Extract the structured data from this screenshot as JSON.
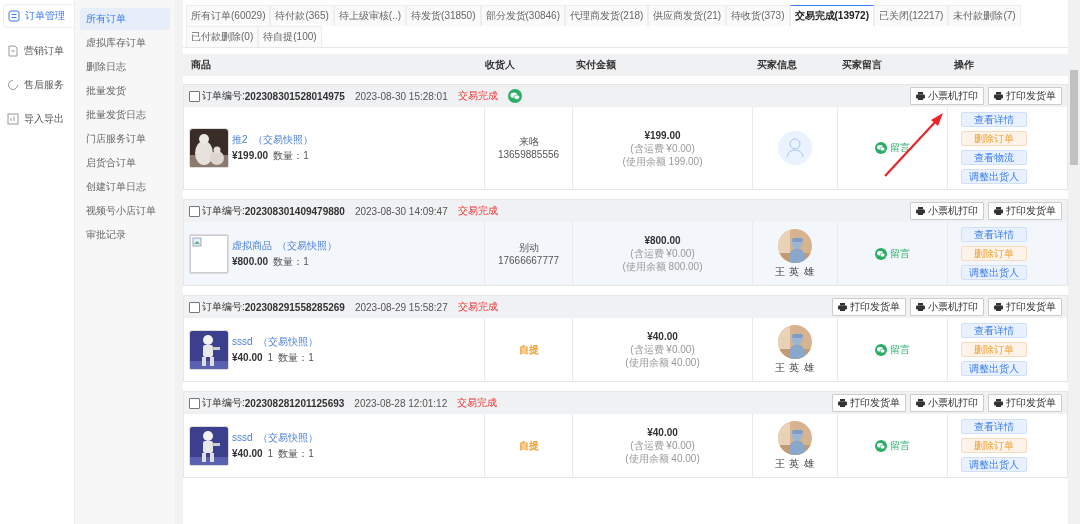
{
  "sidebar": {
    "items": [
      {
        "label": "订单管理",
        "selected": true
      },
      {
        "label": "营销订单",
        "selected": false
      },
      {
        "label": "售后服务",
        "selected": false
      },
      {
        "label": "导入导出",
        "selected": false
      }
    ]
  },
  "submenu": {
    "items": [
      {
        "label": "所有订单",
        "selected": true
      },
      {
        "label": "虚拟库存订单",
        "selected": false
      },
      {
        "label": "删除日志",
        "selected": false
      },
      {
        "label": "批量发货",
        "selected": false
      },
      {
        "label": "批量发货日志",
        "selected": false
      },
      {
        "label": "门店服务订单",
        "selected": false
      },
      {
        "label": "启货合订单",
        "selected": false
      },
      {
        "label": "创建订单日志",
        "selected": false
      },
      {
        "label": "视频号小店订单",
        "selected": false
      },
      {
        "label": "审批记录",
        "selected": false
      }
    ]
  },
  "tabs": [
    {
      "label": "所有订单(60029)",
      "selected": false
    },
    {
      "label": "待付款(365)",
      "selected": false
    },
    {
      "label": "待上级审核(..)",
      "selected": false
    },
    {
      "label": "待发货(31850)",
      "selected": false
    },
    {
      "label": "部分发货(30846)",
      "selected": false
    },
    {
      "label": "代理商发货(218)",
      "selected": false
    },
    {
      "label": "供应商发货(21)",
      "selected": false
    },
    {
      "label": "待收货(373)",
      "selected": false
    },
    {
      "label": "交易完成(13972)",
      "selected": true
    },
    {
      "label": "已关闭(12217)",
      "selected": false
    },
    {
      "label": "未付款删除(7)",
      "selected": false
    },
    {
      "label": "已付款删除(0)",
      "selected": false
    },
    {
      "label": "待自提(100)",
      "selected": false
    }
  ],
  "table": {
    "columns": [
      "商品",
      "收货人",
      "实付金额",
      "买家信息",
      "买家留言",
      "操作"
    ],
    "orders": [
      {
        "checked": false,
        "number_label": "订单编号:",
        "number": "202308301528014975",
        "time": "2023-08-30 15:28:01",
        "status": "交易完成",
        "wechat": true,
        "print_buttons": [
          "小票机打印",
          "打印发货单"
        ],
        "highlight": false,
        "product": {
          "name": "推2",
          "snapshot": "（交易快照）",
          "price": "¥199.00",
          "qty": "数量：1"
        },
        "receiver": {
          "kind": "contact",
          "name": "来咯",
          "phone": "13659885556"
        },
        "amount": {
          "total": "¥199.00",
          "shipping": "(含运费 ¥0.00)",
          "balance": "(使用余额 199.00)"
        },
        "buyer": {
          "kind": "default"
        },
        "message": "留言",
        "actions": [
          {
            "label": "查看详情",
            "kind": "info"
          },
          {
            "label": "删除订单",
            "kind": "danger"
          },
          {
            "label": "查看物流",
            "kind": "info"
          },
          {
            "label": "调整出货人",
            "kind": "info"
          }
        ]
      },
      {
        "checked": false,
        "number_label": "订单编号:",
        "number": "202308301409479880",
        "time": "2023-08-30 14:09:47",
        "status": "交易完成",
        "wechat": false,
        "print_buttons": [
          "小票机打印",
          "打印发货单"
        ],
        "highlight": true,
        "product": {
          "kind": "broken",
          "name": "虚拟商品",
          "snapshot": "（交易快照）",
          "price": "¥800.00",
          "qty": "数量：1"
        },
        "receiver": {
          "kind": "contact",
          "name": "别动",
          "phone": "17666667777"
        },
        "amount": {
          "total": "¥800.00",
          "shipping": "(含运费 ¥0.00)",
          "balance": "(使用余额 800.00)"
        },
        "buyer": {
          "name": "王 英 雄"
        },
        "message": "留言",
        "actions": [
          {
            "label": "查看详情",
            "kind": "info"
          },
          {
            "label": "删除订单",
            "kind": "danger"
          },
          {
            "label": "调整出货人",
            "kind": "info"
          }
        ]
      },
      {
        "checked": false,
        "number_label": "订单编号:",
        "number": "202308291558285269",
        "time": "2023-08-29 15:58:27",
        "status": "交易完成",
        "wechat": false,
        "print_buttons": [
          "打印发货单",
          "小票机打印",
          "打印发货单"
        ],
        "highlight": false,
        "product": {
          "kind": "figure",
          "name": "sssd",
          "snapshot": "（交易快照）",
          "price": "¥40.00",
          "extra": "1",
          "qty": "数量：1"
        },
        "receiver": {
          "kind": "pickup",
          "name": "自提"
        },
        "amount": {
          "total": "¥40.00",
          "shipping": "(含运费 ¥0.00)",
          "balance": "(使用余额 40.00)"
        },
        "buyer": {
          "name": "王 英 雄"
        },
        "message": "留言",
        "actions": [
          {
            "label": "查看详情",
            "kind": "info"
          },
          {
            "label": "删除订单",
            "kind": "danger"
          },
          {
            "label": "调整出货人",
            "kind": "info"
          }
        ]
      },
      {
        "checked": false,
        "number_label": "订单编号:",
        "number": "202308281201125693",
        "time": "2023-08-28 12:01:12",
        "status": "交易完成",
        "wechat": false,
        "print_buttons": [
          "打印发货单",
          "小票机打印",
          "打印发货单"
        ],
        "highlight": false,
        "product": {
          "kind": "figure",
          "name": "sssd",
          "snapshot": "（交易快照）",
          "price": "¥40.00",
          "extra": "1",
          "qty": "数量：1"
        },
        "receiver": {
          "kind": "pickup",
          "name": "自提"
        },
        "amount": {
          "total": "¥40.00",
          "shipping": "(含运费 ¥0.00)",
          "balance": "(使用余额 40.00)"
        },
        "buyer": {
          "name": "王 英 雄"
        },
        "message": "留言",
        "actions": [
          {
            "label": "查看详情",
            "kind": "info"
          },
          {
            "label": "删除订单",
            "kind": "danger"
          },
          {
            "label": "调整出货人",
            "kind": "info"
          }
        ]
      }
    ]
  }
}
